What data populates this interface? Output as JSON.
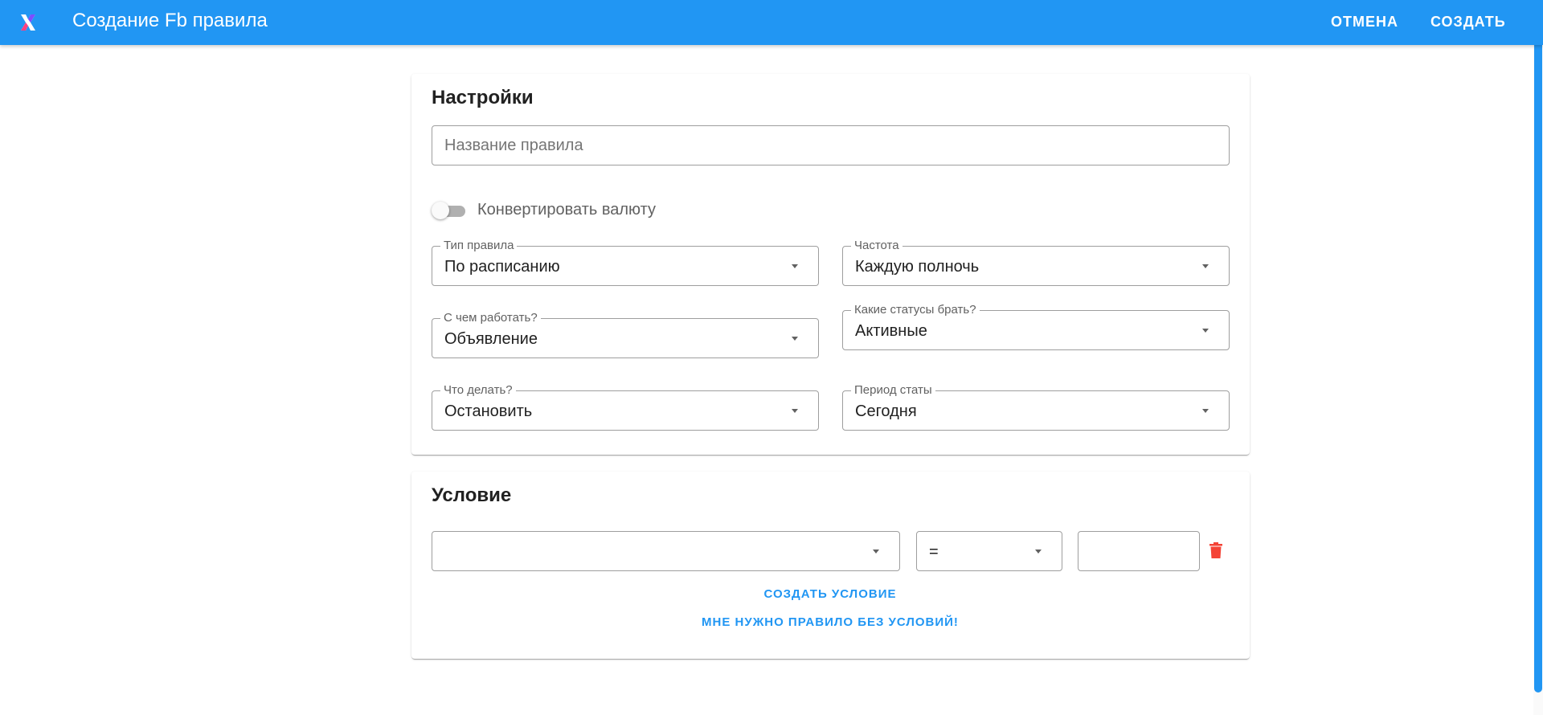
{
  "header": {
    "title": "Создание Fb правила",
    "cancel_label": "ОТМЕНА",
    "create_label": "СОЗДАТЬ",
    "logo_icon": "x-logo-icon",
    "color": "#2196f3"
  },
  "settings": {
    "title": "Настройки",
    "rule_name_placeholder": "Название правила",
    "rule_name_value": "",
    "convert_currency_label": "Конвертировать валюту",
    "convert_currency_on": false,
    "rule_type": {
      "label": "Тип правила",
      "value": "По расписанию"
    },
    "frequency": {
      "label": "Частота",
      "value": "Каждую полночь"
    },
    "work_with": {
      "label": "С чем работать?",
      "value": "Объявление"
    },
    "statuses": {
      "label": "Какие статусы брать?",
      "value": "Активные"
    },
    "action": {
      "label": "Что делать?",
      "value": "Остановить"
    },
    "stats_period": {
      "label": "Период статы",
      "value": "Сегодня"
    }
  },
  "condition": {
    "title": "Условие",
    "metric_value": "",
    "operator_value": "=",
    "threshold_value": "",
    "delete_icon": "trash-icon",
    "delete_color": "#f44336",
    "create_condition_label": "СОЗДАТЬ УСЛОВИЕ",
    "no_conditions_label": "МНЕ НУЖНО ПРАВИЛО БЕЗ УСЛОВИЙ!"
  }
}
